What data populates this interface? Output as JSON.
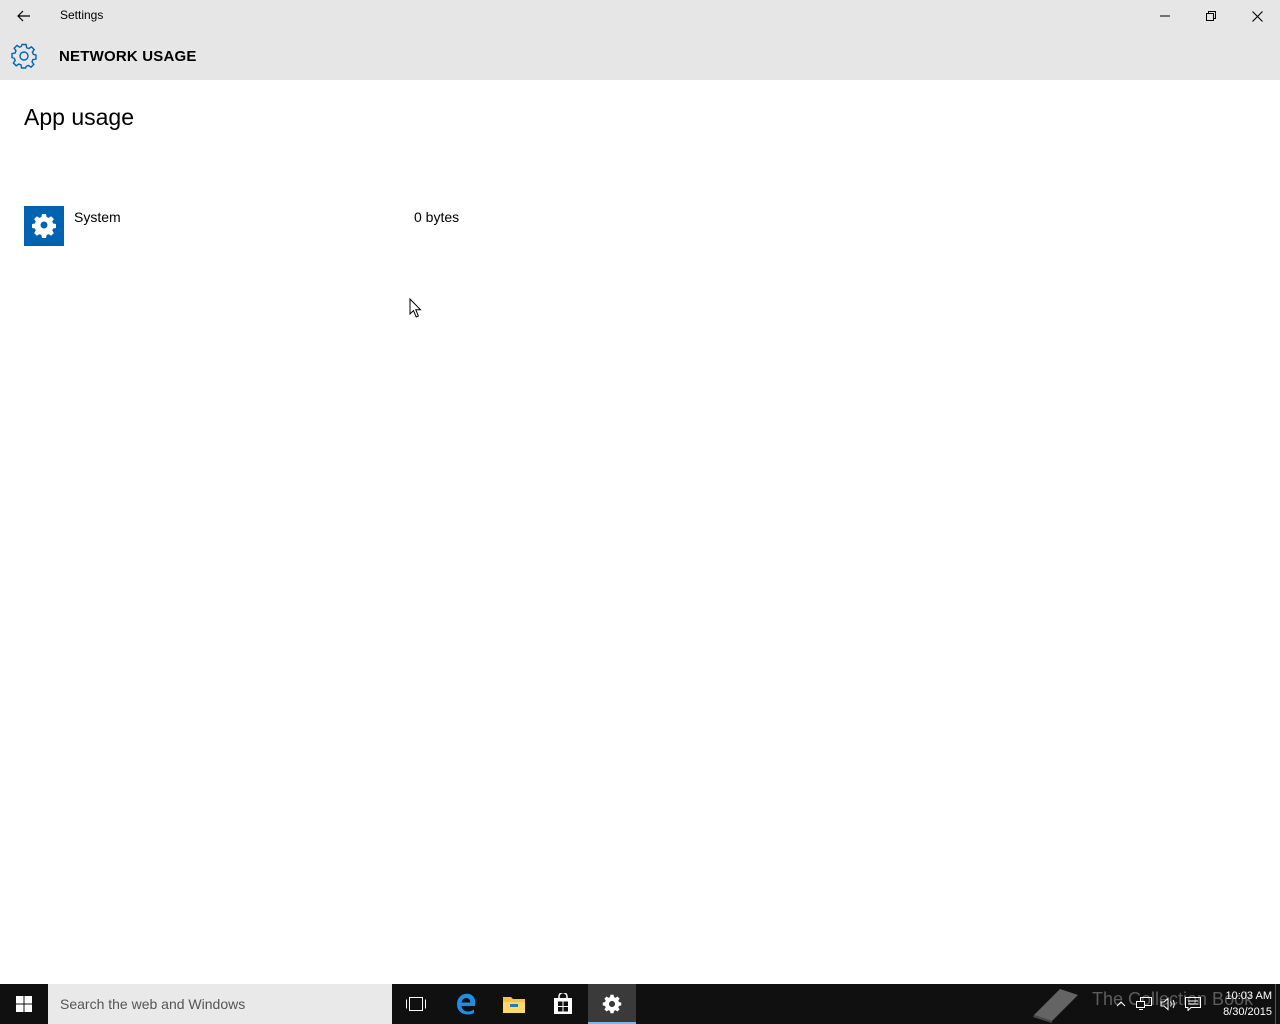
{
  "window": {
    "title": "Settings",
    "header_title": "NETWORK USAGE"
  },
  "content": {
    "page_title": "App usage",
    "apps": [
      {
        "name": "System",
        "usage": "0 bytes",
        "icon": "gear-icon"
      }
    ]
  },
  "taskbar": {
    "search_placeholder": "Search the web and Windows",
    "pinned": [
      "task-view-icon",
      "edge-icon",
      "file-explorer-icon",
      "store-icon",
      "settings-icon"
    ],
    "watermark": "The Collection Book",
    "clock": {
      "time": "10:03 AM",
      "date": "8/30/2015"
    }
  },
  "colors": {
    "accent": "#0063b1",
    "titlebar": "#e6e6e6",
    "taskbar": "#101010"
  }
}
